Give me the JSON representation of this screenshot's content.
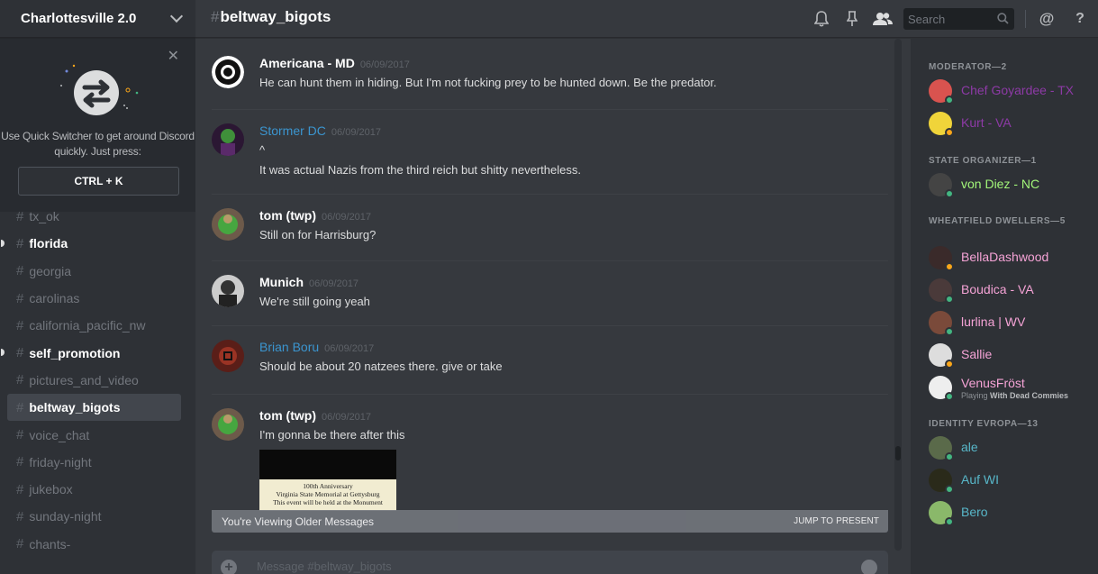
{
  "server": {
    "name": "Charlottesville 2.0"
  },
  "quick_switcher": {
    "text": "Use Quick Switcher to get around Discord quickly. Just press:",
    "shortcut": "CTRL + K"
  },
  "channels": [
    {
      "name": "tx_ok",
      "state": "normal"
    },
    {
      "name": "florida",
      "state": "unread"
    },
    {
      "name": "georgia",
      "state": "normal"
    },
    {
      "name": "carolinas",
      "state": "normal"
    },
    {
      "name": "california_pacific_nw",
      "state": "normal"
    },
    {
      "name": "self_promotion",
      "state": "unread"
    },
    {
      "name": "pictures_and_video",
      "state": "normal"
    },
    {
      "name": "beltway_bigots",
      "state": "active"
    },
    {
      "name": "voice_chat",
      "state": "normal"
    },
    {
      "name": "friday-night",
      "state": "normal"
    },
    {
      "name": "jukebox",
      "state": "normal"
    },
    {
      "name": "sunday-night",
      "state": "normal"
    },
    {
      "name": "chants-",
      "state": "normal"
    }
  ],
  "header": {
    "hash": "#",
    "channel": "beltway_bigots",
    "search_placeholder": "Search"
  },
  "messages": [
    {
      "author": "Americana - MD",
      "time": "06/09/2017",
      "style": "white",
      "lines": [
        "He can hunt them in hiding. But I'm not fucking prey to be hunted down. Be the predator."
      ]
    },
    {
      "author": "Stormer DC",
      "time": "06/09/2017",
      "style": "blue",
      "lines": [
        "^",
        "It was actual Nazis from the third reich but shitty nevertheless."
      ]
    },
    {
      "author": "tom (twp)",
      "time": "06/09/2017",
      "style": "white",
      "lines": [
        "Still on for Harrisburg?"
      ]
    },
    {
      "author": "Munich",
      "time": "06/09/2017",
      "style": "white",
      "lines": [
        "We're still going yeah"
      ]
    },
    {
      "author": "Brian Boru",
      "time": "06/09/2017",
      "style": "blue",
      "lines": [
        "Should be about 20 natzees there. give or take"
      ]
    },
    {
      "author": "tom (twp)",
      "time": "06/09/2017",
      "style": "white",
      "lines": [
        "I'm gonna be there after this"
      ]
    }
  ],
  "embed": {
    "line1": "100th Anniversary",
    "line2": "Virginia State Memorial at Gettysburg",
    "line3": "This event will be held at the Monument"
  },
  "older_banner": {
    "text": "You're Viewing Older Messages",
    "action": "JUMP TO PRESENT"
  },
  "composer": {
    "placeholder": "Message #beltway_bigots"
  },
  "member_groups": [
    {
      "title": "MODERATOR—2",
      "members": [
        {
          "name": "Chef Goyardee - TX",
          "color": "#8d3aa6",
          "status": "online"
        },
        {
          "name": "Kurt - VA",
          "color": "#8d3aa6",
          "status": "idle"
        }
      ]
    },
    {
      "title": "STATE ORGANIZER—1",
      "members": [
        {
          "name": "von Diez - NC",
          "color": "#a2f579",
          "status": "online"
        }
      ]
    },
    {
      "title": "WHEATFIELD DWELLERS—5",
      "members": [
        {
          "name": "BellaDashwood",
          "color": "#f5a3d6",
          "status": "idle"
        },
        {
          "name": "Boudica - VA",
          "color": "#f5a3d6",
          "status": "online"
        },
        {
          "name": "lurlina | WV",
          "color": "#f5a3d6",
          "status": "online"
        },
        {
          "name": "Sallie",
          "color": "#f5a3d6",
          "status": "idle"
        },
        {
          "name": "VenusFröst",
          "color": "#f5a3d6",
          "status": "online",
          "playing_prefix": "Playing",
          "playing": "With Dead Commies"
        }
      ]
    },
    {
      "title": "IDENTITY EVROPA—13",
      "members": [
        {
          "name": "ale",
          "color": "#58b7c9",
          "status": "online"
        },
        {
          "name": "Auf WI",
          "color": "#58b7c9",
          "status": "online"
        },
        {
          "name": "Bero",
          "color": "#58b7c9",
          "status": "online"
        }
      ]
    }
  ]
}
